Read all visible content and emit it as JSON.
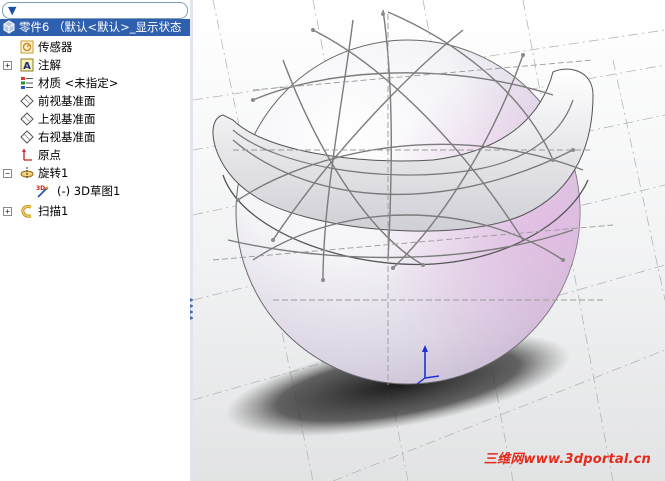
{
  "feature_tree": {
    "root_label": "零件6  （默认<默认>_显示状态",
    "items": [
      {
        "label": "传感器",
        "icon": "sensor-icon",
        "expandable": false
      },
      {
        "label": "注解",
        "icon": "annotation-icon",
        "expandable": true
      },
      {
        "label": "材质 <未指定>",
        "icon": "material-icon",
        "expandable": false
      },
      {
        "label": "前视基准面",
        "icon": "plane-icon",
        "expandable": false
      },
      {
        "label": "上视基准面",
        "icon": "plane-icon",
        "expandable": false
      },
      {
        "label": "右视基准面",
        "icon": "plane-icon",
        "expandable": false
      },
      {
        "label": "原点",
        "icon": "origin-icon",
        "expandable": false
      },
      {
        "label": "旋转1",
        "icon": "revolve-icon",
        "expandable": true,
        "expanded": true
      },
      {
        "label": "(-) 3D草图1",
        "icon": "3d-sketch-icon",
        "expandable": false,
        "child": true
      },
      {
        "label": "扫描1",
        "icon": "sweep-icon",
        "expandable": true
      }
    ]
  },
  "watermark": "三维网www.3dportal.cn",
  "colors": {
    "selection": "#2f5faf",
    "watermark": "#e52a1b",
    "triad_axis": "#1f2fd6"
  }
}
